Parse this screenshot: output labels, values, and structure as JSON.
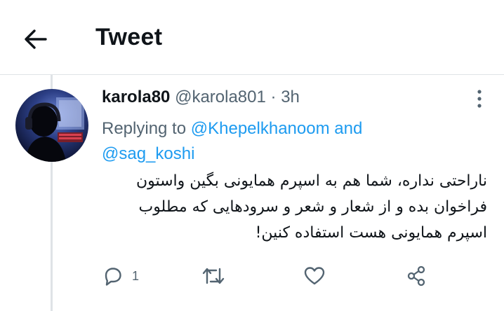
{
  "header": {
    "title": "Tweet",
    "back_icon": "arrow-left-icon"
  },
  "tweet": {
    "display_name": "karola80",
    "handle": "@karola801",
    "separator": "·",
    "time": "3h",
    "replying_prefix": "Replying to",
    "mention_1": "@Khepelkhanoom",
    "replying_joiner": "and",
    "mention_2": "@sag_koshi",
    "text": "ناراحتی نداره، شما هم به اسپرم همایونی بگین واستون فراخوان بده و از شعار و شعر و سرودهایی که مطلوب اسپرم همایونی هست استفاده کنین!",
    "actions": {
      "reply_count": "1",
      "reply_icon": "reply-icon",
      "retweet_icon": "retweet-icon",
      "like_icon": "heart-icon",
      "share_icon": "share-icon"
    }
  },
  "colors": {
    "accent": "#1d9bf0",
    "secondary_text": "#536471",
    "divider": "#dfe3e6"
  }
}
